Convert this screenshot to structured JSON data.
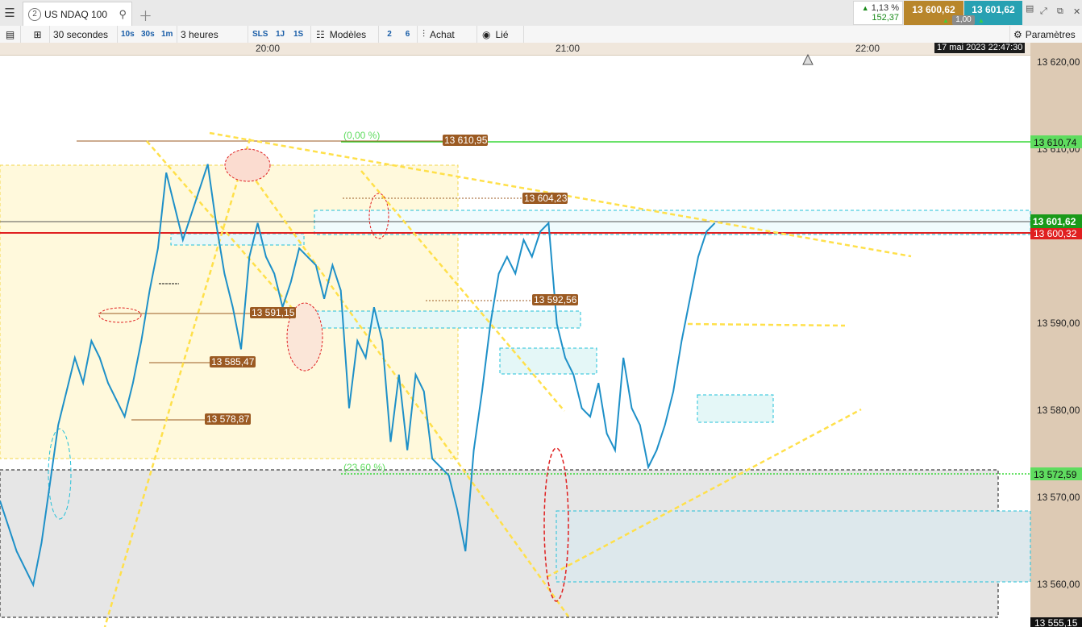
{
  "tab": {
    "number": "2",
    "title": "US NDAQ 100"
  },
  "quote": {
    "change_pct": "1,13 %",
    "change_abs": "152,37",
    "bid": "13 600,62",
    "ask": "13 601,62",
    "qty": "1,00"
  },
  "toolbar": {
    "interval": "30 secondes",
    "q1": "10s",
    "q2": "30s",
    "q3": "1m",
    "range": "3 heures",
    "sls": "SLS",
    "d1": "1J",
    "s1": "1S",
    "models": "Modèles",
    "n2": "2",
    "n6": "6",
    "buy": "Achat",
    "linked": "Lié",
    "settings": "Paramètres"
  },
  "time_axis": {
    "labels": [
      "20:00",
      "21:00",
      "22:00"
    ],
    "cursor_label": "17 mai 2023 22:47:30"
  },
  "price_axis": {
    "ticks": [
      "13 620,00",
      "13 610,00",
      "13 590,00",
      "13 580,00",
      "13 570,00",
      "13 560,00"
    ],
    "markers": {
      "green_top": "13 610,74",
      "last": "13 601,62",
      "red": "13 600,32",
      "green_low": "13 572,59",
      "bottom": "13 555,15"
    }
  },
  "annotations": {
    "fib_top": "(0,00 %)",
    "fib_low": "(23,60 %)",
    "levels": [
      "13 610,95",
      "13 604,23",
      "13 592,56",
      "13 591,15",
      "13 585,47",
      "13 578,87"
    ]
  },
  "colors": {
    "up": "#1e90c8",
    "fib": "#5fdc5f",
    "trend": "#ffe04a",
    "level_label": "#9b5a22",
    "bid": "#b8862b",
    "ask": "#27a1b2"
  },
  "chart_data": {
    "type": "line",
    "x_range": [
      "19:35",
      "22:47"
    ],
    "ylim": [
      13555.15,
      13622
    ],
    "x": [
      0,
      2,
      4,
      6,
      8,
      10,
      12,
      14,
      16,
      18,
      20,
      22,
      24,
      26,
      28,
      30,
      32,
      34,
      36,
      38,
      40,
      42,
      44,
      46,
      48,
      50,
      52,
      54,
      56,
      58,
      60,
      62,
      64,
      66,
      68,
      70,
      72,
      74,
      76,
      78,
      80,
      82,
      84,
      86,
      88,
      90,
      92,
      94,
      96,
      98,
      100,
      102,
      104,
      106,
      108,
      110,
      112,
      114,
      116,
      118,
      120,
      122,
      124,
      126,
      128,
      130,
      132,
      134,
      136,
      138,
      140,
      142,
      144,
      146,
      148,
      150,
      152,
      154,
      156,
      158,
      160,
      162,
      164,
      166,
      168,
      170,
      172,
      174,
      176,
      178,
      180,
      182,
      184,
      186,
      188,
      190,
      192,
      194
    ],
    "y": [
      13569,
      13566,
      13563,
      13561,
      13559,
      13564,
      13571,
      13578,
      13582,
      13586,
      13583,
      13588,
      13586,
      13583,
      13581,
      13579,
      13583,
      13588,
      13594,
      13599,
      13608,
      13604,
      13600,
      13603,
      13606,
      13609,
      13602,
      13596,
      13592,
      13587,
      13598,
      13602,
      13598,
      13596,
      13592,
      13595,
      13599,
      13598,
      13597,
      13593,
      13597,
      13594,
      13580,
      13588,
      13586,
      13592,
      13588,
      13576,
      13584,
      13575,
      13584,
      13582,
      13574,
      13573,
      13572,
      13568,
      13563,
      13575,
      13582,
      13590,
      13596,
      13598,
      13596,
      13600,
      13598,
      13601,
      13602,
      13590,
      13586,
      13584,
      13580,
      13579,
      13583,
      13577,
      13575,
      13586,
      13580,
      13578,
      13573,
      13575,
      13578,
      13582,
      13588,
      13593,
      13598,
      13601,
      13602
    ]
  }
}
